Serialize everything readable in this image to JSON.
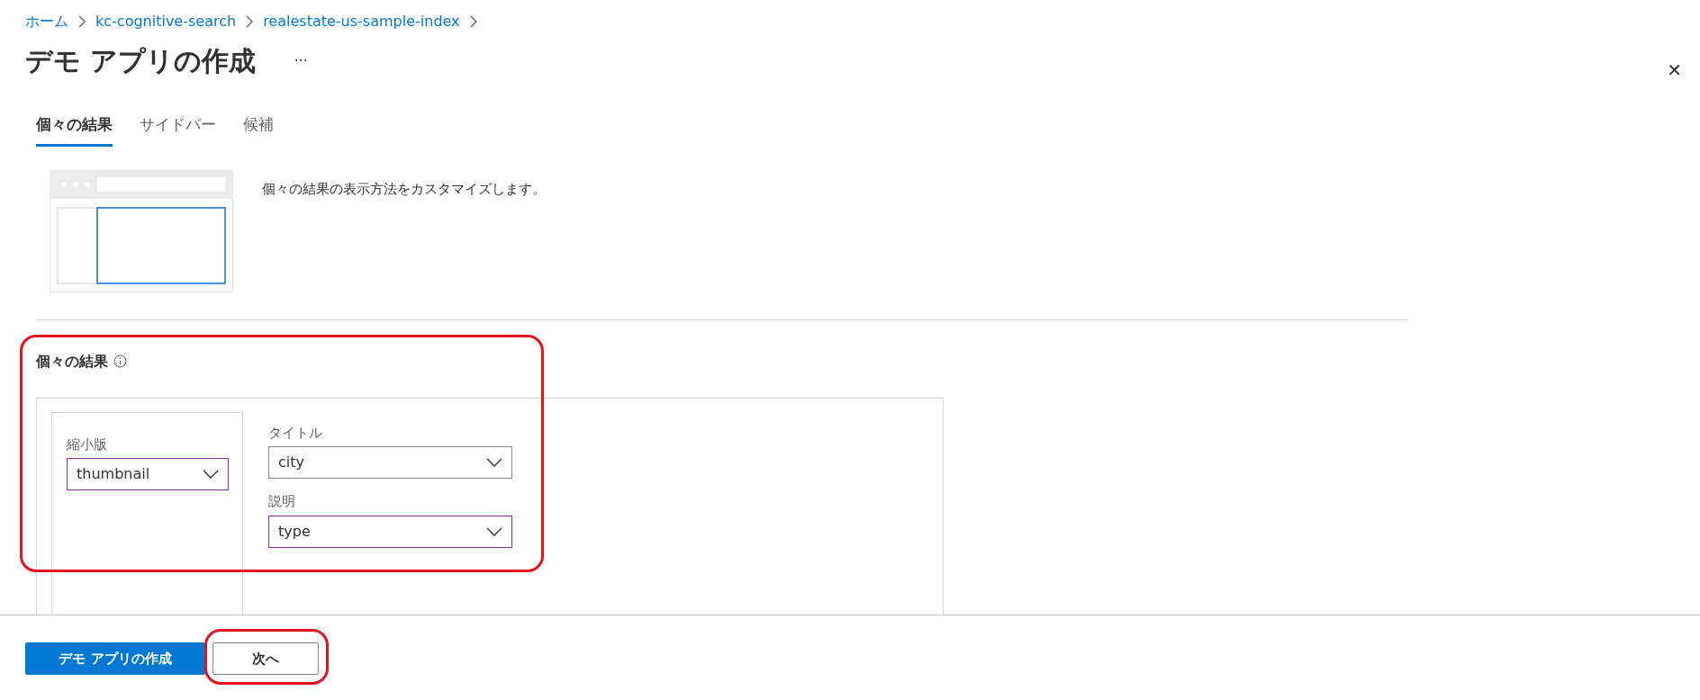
{
  "breadcrumb": [
    "ホーム",
    "kc-cognitive-search",
    "realestate-us-sample-index"
  ],
  "title": "デモ アプリの作成",
  "more": "···",
  "close": "✕",
  "tabs": [
    {
      "label": "個々の結果",
      "selected": true
    },
    {
      "label": "サイドバー",
      "selected": false
    },
    {
      "label": "候補",
      "selected": false
    }
  ],
  "description": "個々の結果の表示方法をカスタマイズします。",
  "section": {
    "heading": "個々の結果",
    "highlighted": true,
    "thumbnail": {
      "label": "縮小版",
      "value": "thumbnail",
      "focused": true
    },
    "fields": [
      {
        "label": "タイトル",
        "value": "city",
        "focused": false
      },
      {
        "label": "説明",
        "value": "type",
        "focused": true
      }
    ]
  },
  "buttons": [
    {
      "label": "デモ アプリの作成",
      "kind": "primary",
      "highlighted": false
    },
    {
      "label": "次へ",
      "kind": "secondary",
      "highlighted": true
    }
  ]
}
